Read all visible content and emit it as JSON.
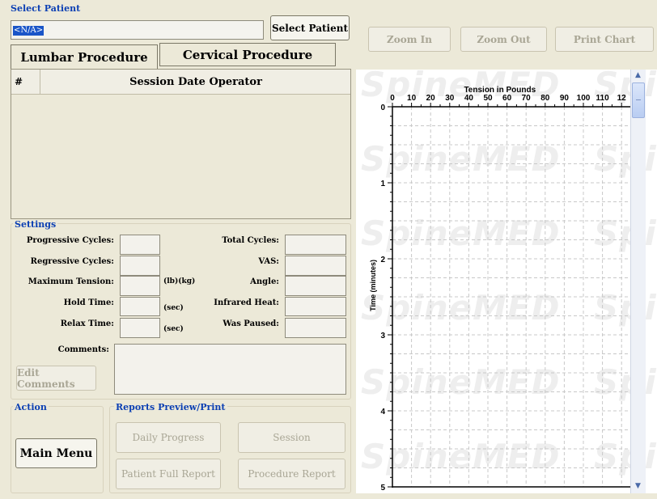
{
  "patient": {
    "group_label": "Select Patient",
    "value": "<N/A>",
    "select_button": "Select Patient"
  },
  "chart_toolbar": {
    "zoom_in": "Zoom In",
    "zoom_out": "Zoom Out",
    "print_chart": "Print Chart"
  },
  "tabs": [
    {
      "label": "Lumbar Procedure",
      "active": true
    },
    {
      "label": "Cervical Procedure",
      "active": false
    }
  ],
  "sessions": {
    "columns": [
      "#",
      "Session Date Operator"
    ],
    "rows": []
  },
  "settings": {
    "group_label": "Settings",
    "left": [
      {
        "label": "Progressive Cycles:",
        "value": "",
        "unit": ""
      },
      {
        "label": "Regressive Cycles:",
        "value": "",
        "unit": ""
      },
      {
        "label": "Maximum Tension:",
        "value": "",
        "unit": "(lb)(kg)"
      },
      {
        "label": "Hold Time:",
        "value": "",
        "unit": "(sec)"
      },
      {
        "label": "Relax Time:",
        "value": "",
        "unit": "(sec)"
      }
    ],
    "right": [
      {
        "label": "Total Cycles:",
        "value": ""
      },
      {
        "label": "VAS:",
        "value": ""
      },
      {
        "label": "Angle:",
        "value": ""
      },
      {
        "label": "Infrared Heat:",
        "value": ""
      },
      {
        "label": "Was Paused:",
        "value": ""
      }
    ],
    "comments_label": "Comments:",
    "comments_value": "",
    "edit_comments": "Edit Comments"
  },
  "action": {
    "group_label": "Action",
    "main_menu": "Main Menu"
  },
  "reports": {
    "group_label": "Reports Preview/Print",
    "daily_progress": "Daily Progress",
    "session": "Session",
    "patient_full_report": "Patient Full Report",
    "procedure_report": "Procedure Report"
  },
  "watermark": "SpineMED",
  "chart_data": {
    "type": "line",
    "title": "Tension in Pounds",
    "xlabel": "",
    "ylabel": "Time (minutes)",
    "x_ticks": [
      "0",
      "10",
      "20",
      "30",
      "40",
      "50",
      "60",
      "70",
      "80",
      "90",
      "100",
      "110",
      "12"
    ],
    "y_ticks": [
      "0",
      "1",
      "2",
      "3",
      "4",
      "5"
    ],
    "xlim": [
      0,
      120
    ],
    "ylim": [
      0,
      5
    ],
    "grid": true,
    "series": []
  },
  "colors": {
    "window_bg": "#ece9d8",
    "group_label": "#0b3fb3",
    "chart_bg": "#ffffff",
    "grid": "#c8c8c8"
  }
}
